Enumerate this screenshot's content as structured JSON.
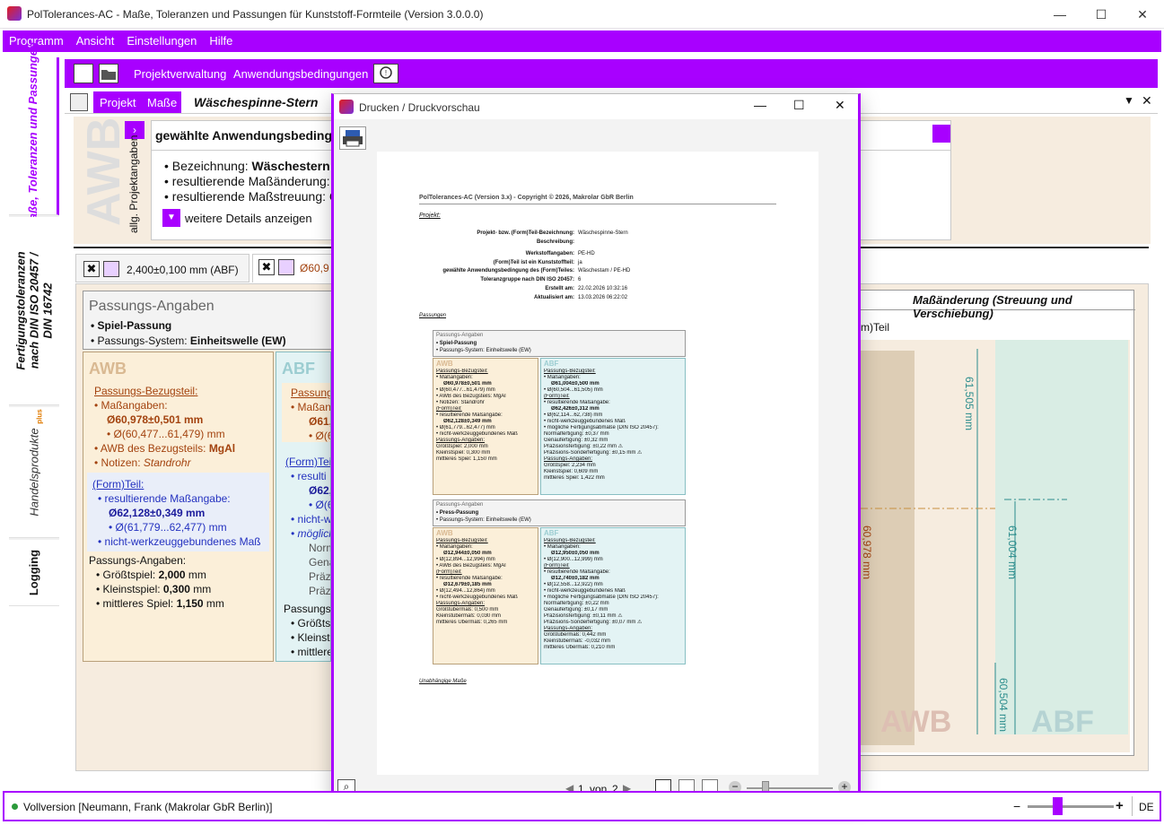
{
  "window": {
    "title": "PolTolerances-AC - Maße, Toleranzen und Passungen für Kunststoff-Formteile (Version 3.0.0.0)",
    "minimize": "—",
    "maximize": "☐",
    "close": "✕"
  },
  "menu": [
    "Programm",
    "Ansicht",
    "Einstellungen",
    "Hilfe"
  ],
  "side_tabs": [
    "Maße, Toleranzen und Passungen",
    "Fertigungstoleranzen nach DIN ISO 20457 / DIN 16742",
    "Handelsprodukte",
    "plus",
    "Logging"
  ],
  "toolbar": {
    "projektverwaltung": "Projektverwaltung",
    "anwendungsbedingungen": "Anwendungsbedingungen"
  },
  "subbar": {
    "tab_projekt": "Projekt",
    "tab_masse": "Maße",
    "project_name": "Wäschespinne-Stern"
  },
  "awb_panel": {
    "big_label": "AWB",
    "side_label": "allg. Projektangaben",
    "heading": "gewählte Anwendungsbedingun",
    "bezeichnung_label": "• Bezeichnung: ",
    "bezeichnung_value": "Wäschestern /",
    "res_aenderung": "• resultierende Maßänderung:",
    "res_streuung": "• resultierende Maßstreuung: C",
    "details": "weitere Details anzeigen"
  },
  "dim_tabs": [
    "2,400±0,100 mm (ABF)",
    "Ø60,9"
  ],
  "passung": {
    "title": "Passungs-Angaben",
    "type": "• Spiel-Passung",
    "system_label": "• Passungs-System: ",
    "system_value": "Einheitswelle (EW)"
  },
  "awb_col": {
    "title": "AWB",
    "bezug": "Passungs-Bezugsteil",
    "massangaben": "• Maßangaben:",
    "nominal": "Ø60,978±0,501 mm",
    "range": "• Ø(60,477...61,479) mm",
    "awb_bezug_label": "• AWB des Bezugsteils: ",
    "awb_bezug_value": "MgAl",
    "notizen_label": "• Notizen: ",
    "notizen_value": "Standrohr",
    "formteil": "(Form)Teil",
    "res_massangabe": "• resultierende Maßangabe:",
    "res_nominal": "Ø62,128±0,349 mm",
    "res_range": "• Ø(61,779...62,477) mm",
    "nicht_wz": "• nicht-werkzeuggebundenes Maß",
    "passungs_angaben": "Passungs-Angaben:",
    "groesst_label": "• Größtspiel: ",
    "groesst_value": "2,000",
    "kleinst_label": "• Kleinstspiel: ",
    "kleinst_value": "0,300",
    "mittel_label": "• mittleres Spiel: ",
    "mittel_value": "1,150",
    "unit": " mm"
  },
  "abf_col": {
    "title": "ABF",
    "lines": [
      "Passungs",
      "• Maßan",
      "Ø61,",
      "• Ø(60",
      "(Form)Teil",
      "• resulti",
      "Ø62,",
      "• Ø(62",
      "• nicht-w",
      "• möglich",
      "Norm",
      "Gena",
      "Präzi",
      "Präzi",
      "Passungs-",
      "• Größts",
      "• Kleinsts",
      "• mittlere"
    ]
  },
  "diagram": {
    "title": "Maßänderung (Streuung und Verschiebung)",
    "partial": "m)Teil",
    "dim1": "61,505 mm",
    "dim2": "61,004 mm",
    "dim3": "60,504 mm",
    "dim4": "60,978 mm",
    "awb": "AWB",
    "abf": "ABF"
  },
  "dialog": {
    "title": "Drucken / Druckvorschau",
    "page": "1",
    "of": "von",
    "total": "2"
  },
  "preview": {
    "header": "PolTolerances-AC (Version 3.x) - Copyright © 2026, Makrolar GbR Berlin",
    "projekt": "Projekt:",
    "rows": [
      [
        "Projekt- bzw. (Form)Teil-Bezeichnung:",
        "Wäschespinne-Stern"
      ],
      [
        "Beschreibung:",
        ""
      ],
      [
        "Werkstoffangaben:",
        "PE-HD"
      ],
      [
        "(Form)Teil ist ein Kunststoffteil:",
        "ja"
      ],
      [
        "gewählte Anwendungsbedingung des (Form)Teiles:",
        "Wäschestam / PE-HD"
      ],
      [
        "Toleranzgruppe nach DIN ISO 20457:",
        "6"
      ],
      [
        "Erstellt am:",
        "22.02.2026 10:32:16"
      ],
      [
        "Aktualisiert am:",
        "13.03.2026 06:22:02"
      ]
    ],
    "passungen": "Passungen",
    "fit1": {
      "title": "Passungs-Angaben",
      "type": "• Spiel-Passung",
      "system": "• Passungs-System: Einheitswelle (EW)",
      "awb": [
        "Passungs-Bezugsteil:",
        "• Maßangaben:",
        "Ø60,978±0,501 mm",
        "• Ø(60,477...61,479) mm",
        "• AWB des Bezugsteils: MgAl",
        "• Notizen: Standrohr",
        "(Form)Teil:",
        "• resultierende Maßangabe:",
        "Ø62,128±0,349 mm",
        "• Ø(61,779...62,477) mm",
        "• nicht-werkzeuggebundenes Maß",
        "Passungs-Angaben:",
        "Größtspiel: 2,000 mm",
        "Kleinstspiel: 0,300 mm",
        "mittleres Spiel: 1,150 mm"
      ],
      "abf": [
        "Passungs-Bezugsteil:",
        "• Maßangaben:",
        "Ø61,004±0,500 mm",
        "• Ø(60,504...61,505) mm",
        "(Form)Teil:",
        "• resultierende Maßangabe:",
        "Ø62,426±0,312 mm",
        "• Ø(62,114...62,738) mm",
        "• nicht-werkzeuggebundenes Maß",
        "• mögliche Fertigungsabmaße (DIN ISO 20457):",
        "Normalfertigung: ±0,37 mm",
        "Genaufertigung: ±0,32 mm",
        "Präzisionsfertigung: ±0,22 mm ⚠",
        "Präzisions-Sonderfertigung: ±0,15 mm ⚠",
        "Passungs-Angaben:",
        "Größtspiel: 2,234 mm",
        "Kleinstspiel: 0,609 mm",
        "mittleres Spiel: 1,422 mm"
      ]
    },
    "fit2": {
      "title": "Passungs-Angaben",
      "type": "• Press-Passung",
      "system": "• Passungs-System: Einheitswelle (EW)",
      "awb": [
        "Passungs-Bezugsteil:",
        "• Maßangaben:",
        "Ø12,944±0,050 mm",
        "• Ø(12,894...12,994) mm",
        "• AWB des Bezugsteils: MgAl",
        "(Form)Teil:",
        "• resultierende Maßangabe:",
        "Ø12,679±0,185 mm",
        "• Ø(12,494...12,864) mm",
        "• nicht-werkzeuggebundenes Maß",
        "Passungs-Angaben:",
        "Größtübermaß: 0,500 mm",
        "Kleinstübermaß: 0,030 mm",
        "mittleres Übermaß: 0,265 mm"
      ],
      "abf": [
        "Passungs-Bezugsteil:",
        "• Maßangaben:",
        "Ø12,950±0,050 mm",
        "• Ø(12,900...12,999) mm",
        "(Form)Teil:",
        "• resultierende Maßangabe:",
        "Ø12,740±0,182 mm",
        "• Ø(12,558...12,922) mm",
        "• nicht-werkzeuggebundenes Maß",
        "• mögliche Fertigungsabmaße (DIN ISO 20457):",
        "Normalfertigung: ±0,22 mm",
        "Genaufertigung: ±0,17 mm",
        "Präzisionsfertigung: ±0,11 mm ⚠",
        "Präzisions-Sonderfertigung: ±0,07 mm ⚠",
        "Passungs-Angaben:",
        "Größtübermaß: 0,442 mm",
        "Kleinstübermaß: -0,032 mm",
        "mittleres Übermaß: 0,210 mm"
      ]
    },
    "footer_link": "Unabhängige Maße"
  },
  "status": {
    "text": "Vollversion [Neumann, Frank (Makrolar GbR Berlin)]",
    "lang": "DE",
    "minus": "−",
    "plus": "+"
  },
  "colors": {
    "accent": "#a800ff",
    "awb_bg": "#fbefd9",
    "abf_bg": "#e3f3f4",
    "dim_brown": "#a3430f",
    "dim_blue": "#1c1c9c"
  }
}
